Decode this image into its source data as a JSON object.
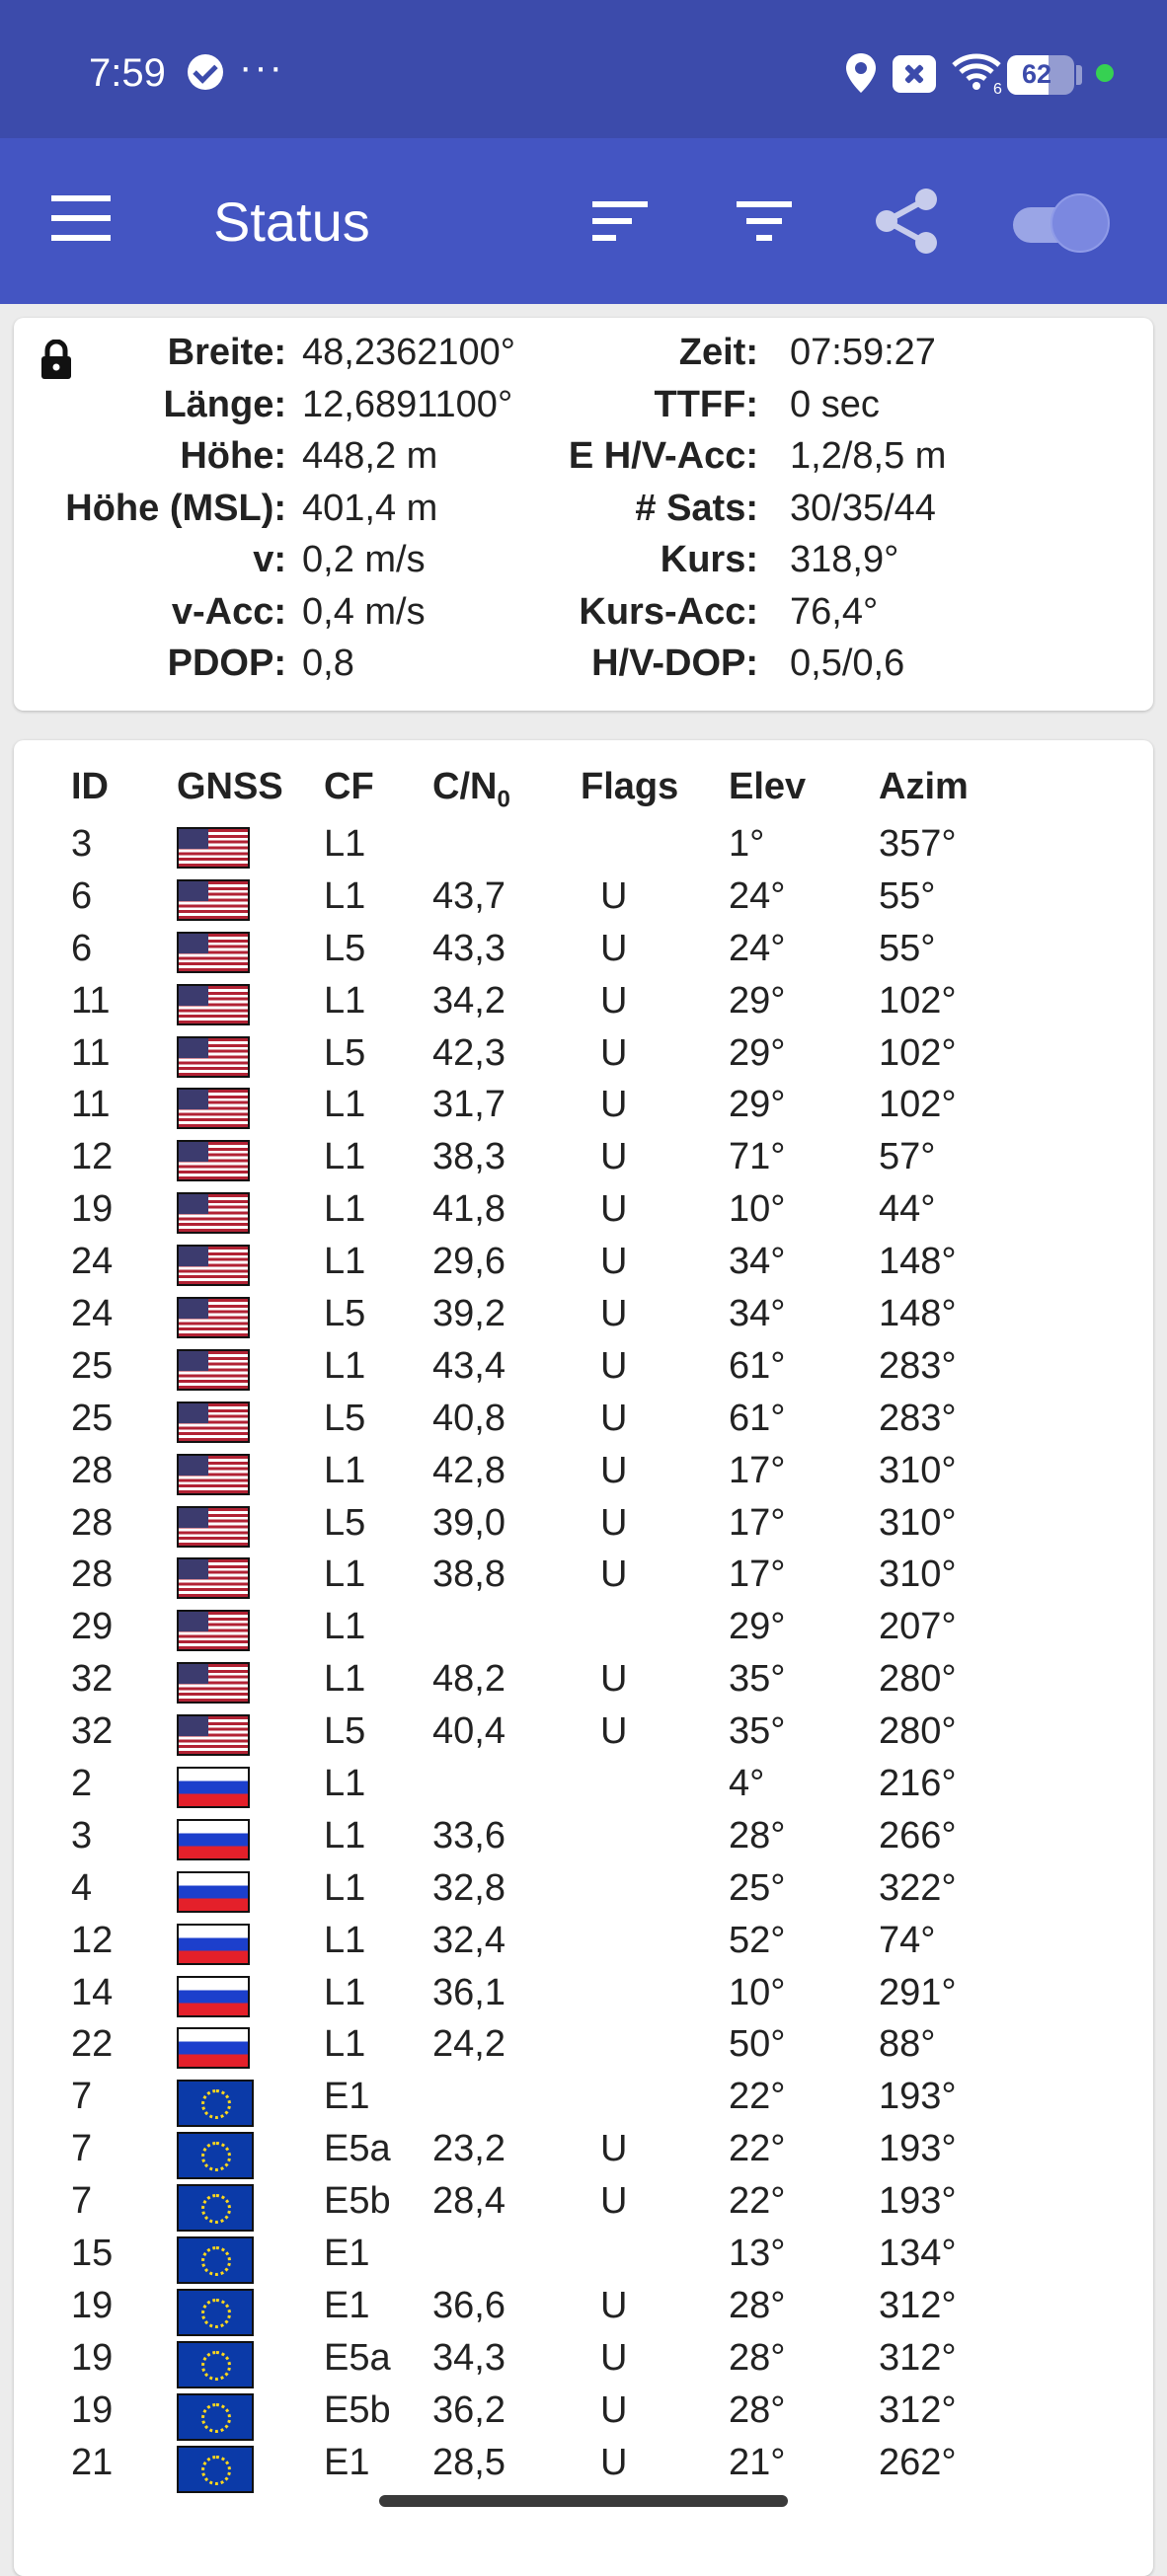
{
  "status_bar": {
    "time": "7:59",
    "more": "···",
    "battery": "62",
    "battery_level_percent": 62,
    "wifi_badge": "6",
    "icons": [
      "check-circle-icon",
      "location-pin-icon",
      "close-box-icon",
      "wifi-icon",
      "battery-icon",
      "green-dot-icon"
    ]
  },
  "app_bar": {
    "title": "Status",
    "icons": [
      "menu-icon",
      "sort-icon",
      "filter-icon",
      "share-icon",
      "toggle-switch"
    ],
    "toggle_on": true
  },
  "info": {
    "left": [
      {
        "label": "Breite:",
        "value": "48,2362100°"
      },
      {
        "label": "Länge:",
        "value": "12,6891100°"
      },
      {
        "label": "Höhe:",
        "value": "448,2 m"
      },
      {
        "label": "Höhe (MSL):",
        "value": "401,4 m"
      },
      {
        "label": "v:",
        "value": "0,2 m/s"
      },
      {
        "label": "v-Acc:",
        "value": "0,4 m/s"
      },
      {
        "label": "PDOP:",
        "value": "0,8"
      }
    ],
    "right": [
      {
        "label": "Zeit:",
        "value": "07:59:27"
      },
      {
        "label": "TTFF:",
        "value": "0 sec"
      },
      {
        "label": "E H/V-Acc:",
        "value": "1,2/8,5 m"
      },
      {
        "label": "# Sats:",
        "value": "30/35/44"
      },
      {
        "label": "Kurs:",
        "value": "318,9°"
      },
      {
        "label": "Kurs-Acc:",
        "value": "76,4°"
      },
      {
        "label": "H/V-DOP:",
        "value": "0,5/0,6"
      }
    ]
  },
  "table": {
    "headers": {
      "id": "ID",
      "gnss": "GNSS",
      "cf": "CF",
      "cn": "C/N",
      "cn_sub": "0",
      "flags": "Flags",
      "elev": "Elev",
      "azim": "Azim"
    },
    "rows": [
      {
        "id": "3",
        "gnss": "us",
        "cf": "L1",
        "cn": "",
        "flags": "",
        "elev": "1°",
        "azim": "357°"
      },
      {
        "id": "6",
        "gnss": "us",
        "cf": "L1",
        "cn": "43,7",
        "flags": "U",
        "elev": "24°",
        "azim": "55°"
      },
      {
        "id": "6",
        "gnss": "us",
        "cf": "L5",
        "cn": "43,3",
        "flags": "U",
        "elev": "24°",
        "azim": "55°"
      },
      {
        "id": "11",
        "gnss": "us",
        "cf": "L1",
        "cn": "34,2",
        "flags": "U",
        "elev": "29°",
        "azim": "102°"
      },
      {
        "id": "11",
        "gnss": "us",
        "cf": "L5",
        "cn": "42,3",
        "flags": "U",
        "elev": "29°",
        "azim": "102°"
      },
      {
        "id": "11",
        "gnss": "us",
        "cf": "L1",
        "cn": "31,7",
        "flags": "U",
        "elev": "29°",
        "azim": "102°"
      },
      {
        "id": "12",
        "gnss": "us",
        "cf": "L1",
        "cn": "38,3",
        "flags": "U",
        "elev": "71°",
        "azim": "57°"
      },
      {
        "id": "19",
        "gnss": "us",
        "cf": "L1",
        "cn": "41,8",
        "flags": "U",
        "elev": "10°",
        "azim": "44°"
      },
      {
        "id": "24",
        "gnss": "us",
        "cf": "L1",
        "cn": "29,6",
        "flags": "U",
        "elev": "34°",
        "azim": "148°"
      },
      {
        "id": "24",
        "gnss": "us",
        "cf": "L5",
        "cn": "39,2",
        "flags": "U",
        "elev": "34°",
        "azim": "148°"
      },
      {
        "id": "25",
        "gnss": "us",
        "cf": "L1",
        "cn": "43,4",
        "flags": "U",
        "elev": "61°",
        "azim": "283°"
      },
      {
        "id": "25",
        "gnss": "us",
        "cf": "L5",
        "cn": "40,8",
        "flags": "U",
        "elev": "61°",
        "azim": "283°"
      },
      {
        "id": "28",
        "gnss": "us",
        "cf": "L1",
        "cn": "42,8",
        "flags": "U",
        "elev": "17°",
        "azim": "310°"
      },
      {
        "id": "28",
        "gnss": "us",
        "cf": "L5",
        "cn": "39,0",
        "flags": "U",
        "elev": "17°",
        "azim": "310°"
      },
      {
        "id": "28",
        "gnss": "us",
        "cf": "L1",
        "cn": "38,8",
        "flags": "U",
        "elev": "17°",
        "azim": "310°"
      },
      {
        "id": "29",
        "gnss": "us",
        "cf": "L1",
        "cn": "",
        "flags": "",
        "elev": "29°",
        "azim": "207°"
      },
      {
        "id": "32",
        "gnss": "us",
        "cf": "L1",
        "cn": "48,2",
        "flags": "U",
        "elev": "35°",
        "azim": "280°"
      },
      {
        "id": "32",
        "gnss": "us",
        "cf": "L5",
        "cn": "40,4",
        "flags": "U",
        "elev": "35°",
        "azim": "280°"
      },
      {
        "id": "2",
        "gnss": "ru",
        "cf": "L1",
        "cn": "",
        "flags": "",
        "elev": "4°",
        "azim": "216°"
      },
      {
        "id": "3",
        "gnss": "ru",
        "cf": "L1",
        "cn": "33,6",
        "flags": "",
        "elev": "28°",
        "azim": "266°"
      },
      {
        "id": "4",
        "gnss": "ru",
        "cf": "L1",
        "cn": "32,8",
        "flags": "",
        "elev": "25°",
        "azim": "322°"
      },
      {
        "id": "12",
        "gnss": "ru",
        "cf": "L1",
        "cn": "32,4",
        "flags": "",
        "elev": "52°",
        "azim": "74°"
      },
      {
        "id": "14",
        "gnss": "ru",
        "cf": "L1",
        "cn": "36,1",
        "flags": "",
        "elev": "10°",
        "azim": "291°"
      },
      {
        "id": "22",
        "gnss": "ru",
        "cf": "L1",
        "cn": "24,2",
        "flags": "",
        "elev": "50°",
        "azim": "88°"
      },
      {
        "id": "7",
        "gnss": "eu",
        "cf": "E1",
        "cn": "",
        "flags": "",
        "elev": "22°",
        "azim": "193°"
      },
      {
        "id": "7",
        "gnss": "eu",
        "cf": "E5a",
        "cn": "23,2",
        "flags": "U",
        "elev": "22°",
        "azim": "193°"
      },
      {
        "id": "7",
        "gnss": "eu",
        "cf": "E5b",
        "cn": "28,4",
        "flags": "U",
        "elev": "22°",
        "azim": "193°"
      },
      {
        "id": "15",
        "gnss": "eu",
        "cf": "E1",
        "cn": "",
        "flags": "",
        "elev": "13°",
        "azim": "134°"
      },
      {
        "id": "19",
        "gnss": "eu",
        "cf": "E1",
        "cn": "36,6",
        "flags": "U",
        "elev": "28°",
        "azim": "312°"
      },
      {
        "id": "19",
        "gnss": "eu",
        "cf": "E5a",
        "cn": "34,3",
        "flags": "U",
        "elev": "28°",
        "azim": "312°"
      },
      {
        "id": "19",
        "gnss": "eu",
        "cf": "E5b",
        "cn": "36,2",
        "flags": "U",
        "elev": "28°",
        "azim": "312°"
      },
      {
        "id": "21",
        "gnss": "eu",
        "cf": "E1",
        "cn": "28,5",
        "flags": "U",
        "elev": "21°",
        "azim": "262°"
      }
    ]
  },
  "colors": {
    "status_bar": "#3c4bab",
    "app_bar": "#4455c2",
    "background": "#ececec"
  }
}
